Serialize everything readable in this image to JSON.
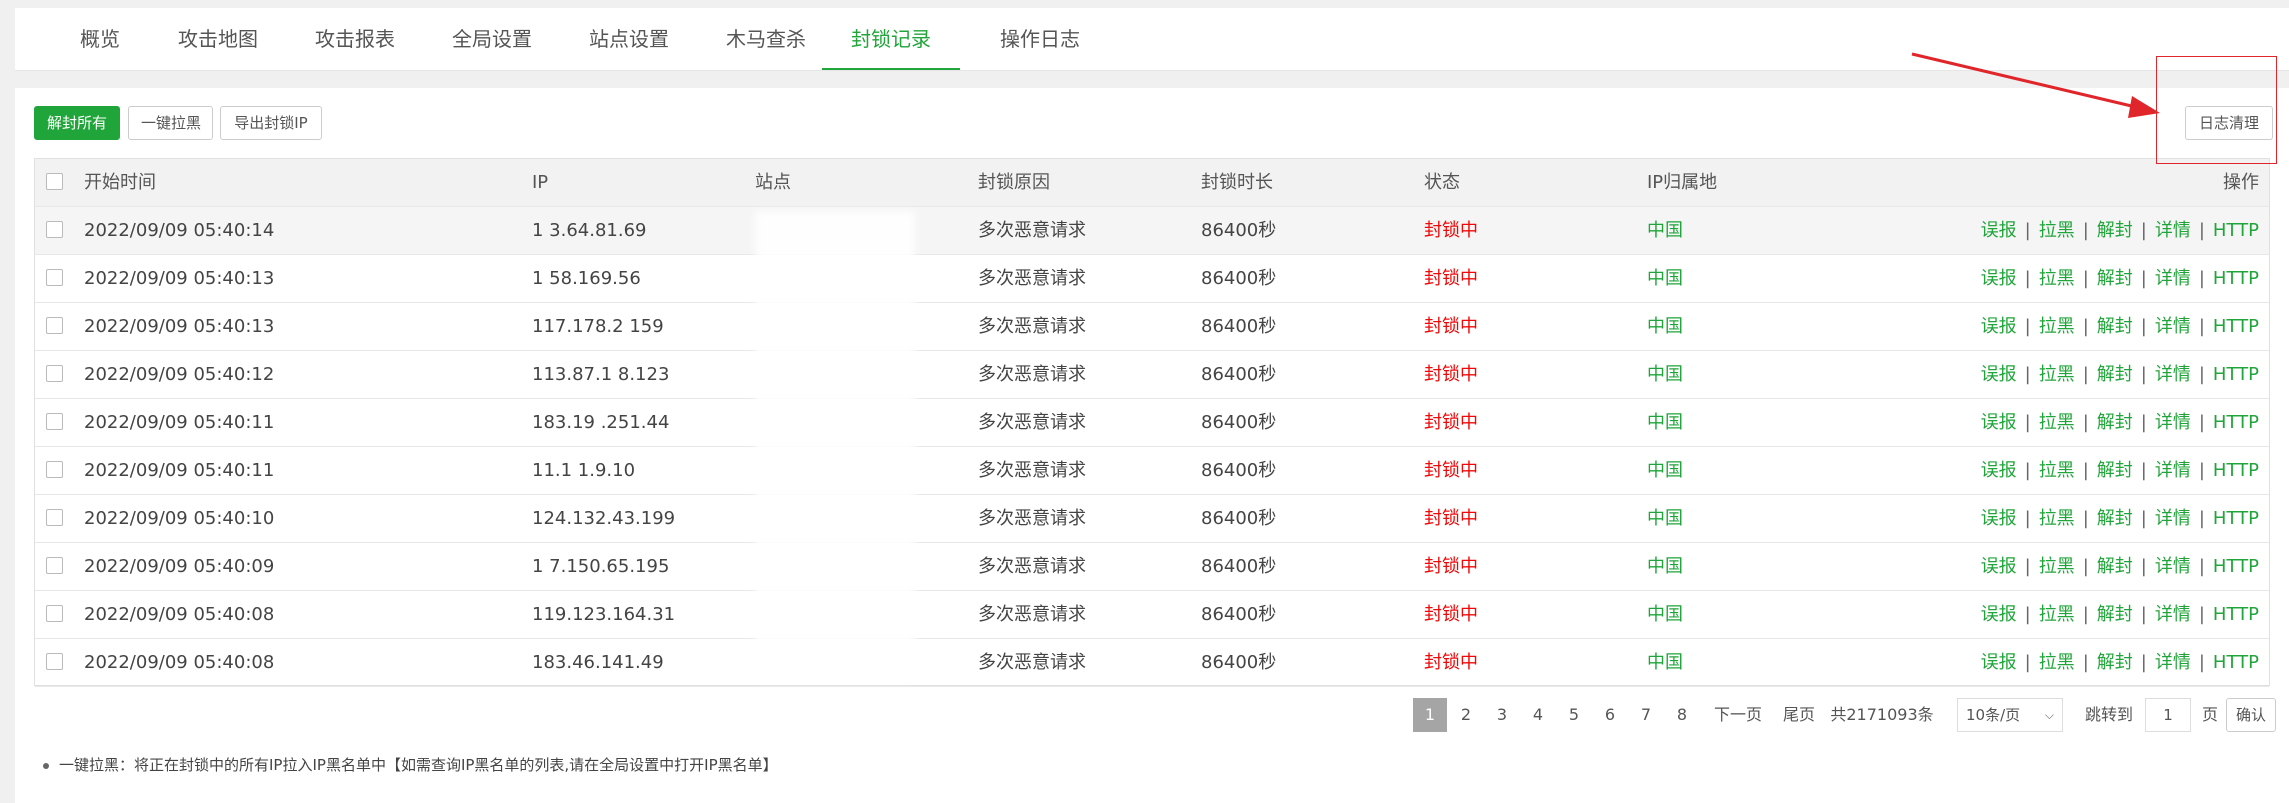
{
  "tabs": [
    {
      "label": "概览",
      "active": false
    },
    {
      "label": "攻击地图",
      "active": false
    },
    {
      "label": "攻击报表",
      "active": false
    },
    {
      "label": "全局设置",
      "active": false
    },
    {
      "label": "站点设置",
      "active": false
    },
    {
      "label": "木马查杀",
      "active": false
    },
    {
      "label": "封锁记录",
      "active": true
    },
    {
      "label": "操作日志",
      "active": false
    }
  ],
  "toolbar": {
    "unblock_all": "解封所有",
    "blacklist_all": "一键拉黑",
    "export_ip": "导出封锁IP",
    "log_clean": "日志清理"
  },
  "table": {
    "headers": {
      "start_time": "开始时间",
      "ip": "IP",
      "site": "站点",
      "reason": "封锁原因",
      "duration": "封锁时长",
      "status": "状态",
      "ip_location": "IP归属地",
      "actions": "操作"
    },
    "rows": [
      {
        "time": "2022/09/09 05:40:14",
        "ip": "1 3.64.81.69",
        "reason": "多次恶意请求",
        "duration": "86400秒",
        "status": "封锁中",
        "location": "中国"
      },
      {
        "time": "2022/09/09 05:40:13",
        "ip": "1 58.169.56",
        "reason": "多次恶意请求",
        "duration": "86400秒",
        "status": "封锁中",
        "location": "中国"
      },
      {
        "time": "2022/09/09 05:40:13",
        "ip": "117.178.2 159",
        "reason": "多次恶意请求",
        "duration": "86400秒",
        "status": "封锁中",
        "location": "中国"
      },
      {
        "time": "2022/09/09 05:40:12",
        "ip": "113.87.1 8.123",
        "reason": "多次恶意请求",
        "duration": "86400秒",
        "status": "封锁中",
        "location": "中国"
      },
      {
        "time": "2022/09/09 05:40:11",
        "ip": "183.19 .251.44",
        "reason": "多次恶意请求",
        "duration": "86400秒",
        "status": "封锁中",
        "location": "中国"
      },
      {
        "time": "2022/09/09 05:40:11",
        "ip": "11.1 1.9.10",
        "reason": "多次恶意请求",
        "duration": "86400秒",
        "status": "封锁中",
        "location": "中国"
      },
      {
        "time": "2022/09/09 05:40:10",
        "ip": "124.132.43.199",
        "reason": "多次恶意请求",
        "duration": "86400秒",
        "status": "封锁中",
        "location": "中国"
      },
      {
        "time": "2022/09/09 05:40:09",
        "ip": "1 7.150.65.195",
        "reason": "多次恶意请求",
        "duration": "86400秒",
        "status": "封锁中",
        "location": "中国"
      },
      {
        "time": "2022/09/09 05:40:08",
        "ip": "119.123.164.31",
        "reason": "多次恶意请求",
        "duration": "86400秒",
        "status": "封锁中",
        "location": "中国"
      },
      {
        "time": "2022/09/09 05:40:08",
        "ip": "183.46.141.49",
        "reason": "多次恶意请求",
        "duration": "86400秒",
        "status": "封锁中",
        "location": "中国"
      }
    ],
    "row_actions": [
      "误报",
      "拉黑",
      "解封",
      "详情",
      "HTTP"
    ],
    "action_separator": "|"
  },
  "pagination": {
    "pages": [
      "1",
      "2",
      "3",
      "4",
      "5",
      "6",
      "7",
      "8"
    ],
    "current": "1",
    "next": "下一页",
    "last": "尾页",
    "total": "共2171093条",
    "per_page": "10条/页",
    "jump_label": "跳转到",
    "jump_value": "1",
    "page_unit": "页",
    "confirm": "确认"
  },
  "note": "一键拉黑：将正在封锁中的所有IP拉入IP黑名单中【如需查询IP黑名单的列表,请在全局设置中打开IP黑名单】",
  "colors": {
    "accent": "#20a53a",
    "danger": "#ef0808",
    "annotation": "#e0262a"
  }
}
